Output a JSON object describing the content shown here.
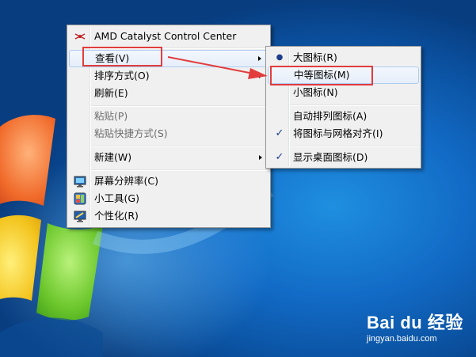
{
  "colors": {
    "desktop_blue": "#1470cc",
    "menu_bg": "#f0f0f0",
    "menu_border": "#979797",
    "highlight_border": "#aecbf0",
    "callout_red": "#e23c3c"
  },
  "context_menu": {
    "items": [
      {
        "label": "AMD Catalyst Control Center",
        "icon": "amd-catalyst-icon"
      },
      {
        "label": "查看(V)",
        "has_submenu": true
      },
      {
        "label": "排序方式(O)",
        "has_submenu": true
      },
      {
        "label": "刷新(E)"
      },
      {
        "label": "粘贴(P)",
        "disabled": true
      },
      {
        "label": "粘贴快捷方式(S)",
        "disabled": true
      },
      {
        "label": "新建(W)",
        "has_submenu": true
      },
      {
        "label": "屏幕分辨率(C)",
        "icon": "screen-resolution-icon"
      },
      {
        "label": "小工具(G)",
        "icon": "gadgets-icon"
      },
      {
        "label": "个性化(R)",
        "icon": "personalize-icon"
      }
    ]
  },
  "view_submenu": {
    "items": [
      {
        "label": "大图标(R)",
        "mark": "radio-bullet"
      },
      {
        "label": "中等图标(M)",
        "highlighted": true
      },
      {
        "label": "小图标(N)"
      },
      {
        "label": "自动排列图标(A)"
      },
      {
        "label": "将图标与网格对齐(I)",
        "mark": "checkmark"
      },
      {
        "label": "显示桌面图标(D)",
        "mark": "checkmark"
      }
    ],
    "bullet": "●",
    "check": "✓"
  },
  "watermark": {
    "logo": "Bai du 经验",
    "url": "jingyan.baidu.com"
  }
}
